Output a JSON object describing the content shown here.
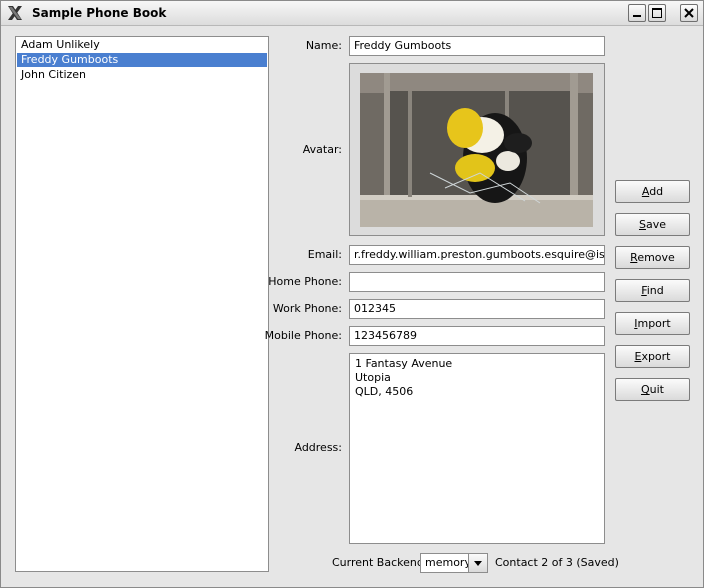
{
  "window": {
    "title": "Sample Phone Book",
    "icons": {
      "app": "x-logo-icon",
      "minimize": "minimize-icon",
      "maximize": "maximize-icon",
      "close": "close-icon"
    }
  },
  "contacts": [
    {
      "name": "Adam Unlikely",
      "selected": false
    },
    {
      "name": "Freddy Gumboots",
      "selected": true
    },
    {
      "name": "John Citizen",
      "selected": false
    }
  ],
  "form": {
    "name_label": "Name:",
    "name_value": "Freddy Gumboots",
    "avatar_label": "Avatar:",
    "email_label": "Email:",
    "email_value": "r.freddy.william.preston.gumboots.esquire@isp.com",
    "home_phone_label": "Home Phone:",
    "home_phone_value": "",
    "work_phone_label": "Work Phone:",
    "work_phone_value": "012345",
    "mobile_phone_label": "Mobile Phone:",
    "mobile_phone_value": "123456789",
    "address_label": "Address:",
    "address_lines": [
      "1 Fantasy Avenue",
      "Utopia",
      "QLD, 4506"
    ]
  },
  "buttons": {
    "add": {
      "mnemonic": "A",
      "rest": "dd"
    },
    "save": {
      "mnemonic": "S",
      "rest": "ave"
    },
    "remove": {
      "mnemonic": "R",
      "rest": "emove"
    },
    "find": {
      "mnemonic": "F",
      "rest": "ind"
    },
    "import": {
      "mnemonic": "I",
      "rest": "mport"
    },
    "export": {
      "mnemonic": "E",
      "rest": "xport"
    },
    "quit": {
      "mnemonic": "Q",
      "rest": "uit"
    }
  },
  "footer": {
    "backend_label": "Current Backend:",
    "backend_value": "memory",
    "status": "Contact 2 of 3 (Saved)"
  },
  "colors": {
    "selection": "#4a7fd0",
    "window_bg": "#e6e6e6"
  }
}
